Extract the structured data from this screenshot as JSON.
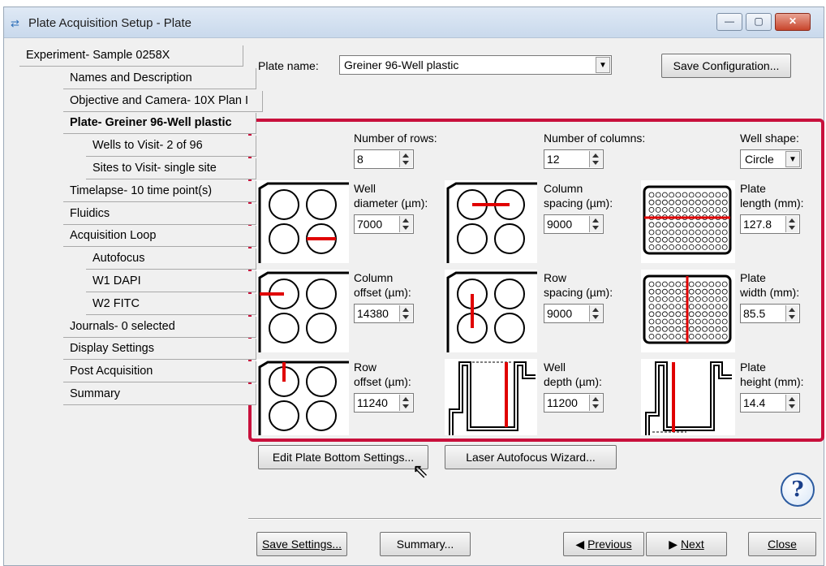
{
  "window": {
    "title": "Plate Acquisition Setup - Plate",
    "min": "—",
    "max": "▢",
    "close": "✕"
  },
  "nav": [
    {
      "label": "Experiment- Sample 0258X"
    },
    {
      "label": "Names and Description"
    },
    {
      "label": "Objective and Camera- 10X Plan I"
    },
    {
      "label": "Plate- Greiner 96-Well plastic"
    },
    {
      "label": "Wells to Visit- 2 of 96"
    },
    {
      "label": "Sites to Visit- single site"
    },
    {
      "label": "Timelapse- 10 time point(s)"
    },
    {
      "label": "Fluidics"
    },
    {
      "label": "Acquisition Loop"
    },
    {
      "label": "Autofocus"
    },
    {
      "label": "W1 DAPI"
    },
    {
      "label": "W2 FITC"
    },
    {
      "label": "Journals- 0 selected"
    },
    {
      "label": "Display Settings"
    },
    {
      "label": "Post Acquisition"
    },
    {
      "label": "Summary"
    }
  ],
  "plate": {
    "name_label": "Plate name:",
    "name_value": "Greiner 96-Well plastic",
    "save_config": "Save Configuration..."
  },
  "fields": {
    "rows_label": "Number of rows:",
    "rows": "8",
    "cols_label": "Number of columns:",
    "cols": "12",
    "shape_label": "Well shape:",
    "shape": "Circle",
    "well_diam_l1": "Well",
    "well_diam_l2": "diameter (µm):",
    "well_diam": "7000",
    "col_spacing_l1": "Column",
    "col_spacing_l2": "spacing (µm):",
    "col_spacing": "9000",
    "plate_len_l1": "Plate",
    "plate_len_l2": "length (mm):",
    "plate_len": "127.8",
    "col_off_l1": "Column",
    "col_off_l2": "offset (µm):",
    "col_off": "14380",
    "row_spacing_l1": "Row",
    "row_spacing_l2": "spacing (µm):",
    "row_spacing": "9000",
    "plate_w_l1": "Plate",
    "plate_w_l2": "width (mm):",
    "plate_w": "85.5",
    "row_off_l1": "Row",
    "row_off_l2": "offset (µm):",
    "row_off": "11240",
    "well_depth_l1": "Well",
    "well_depth_l2": "depth (µm):",
    "well_depth": "11200",
    "plate_h_l1": "Plate",
    "plate_h_l2": "height (mm):",
    "plate_h": "14.4"
  },
  "buttons": {
    "edit_bottom": "Edit Plate Bottom Settings...",
    "laser_af": "Laser Autofocus Wizard...",
    "help": "?",
    "save_settings": "Save Settings...",
    "summary": "Summary...",
    "previous": "Previous",
    "next": "Next",
    "close": "Close"
  },
  "colors": {
    "highlight": "#c8103c",
    "marker": "#e00000"
  }
}
